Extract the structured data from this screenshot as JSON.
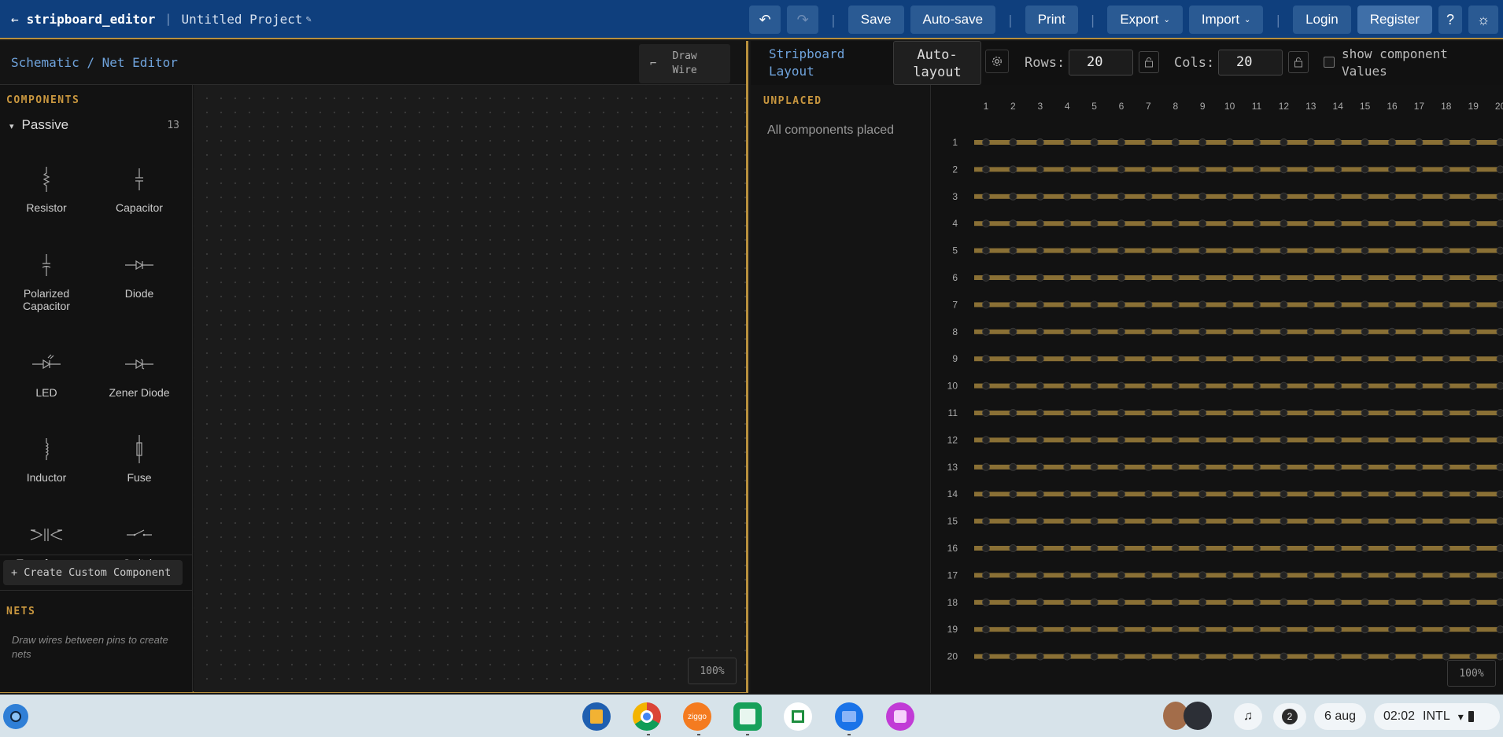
{
  "topbar": {
    "back_label": "←",
    "app_name": "stripboard_editor",
    "separator": "|",
    "project_name": "Untitled Project",
    "pencil_icon": "✎",
    "undo_icon": "↶",
    "redo_icon": "↷",
    "save": "Save",
    "autosave": "Auto-save",
    "print": "Print",
    "export": "Export",
    "import": "Import",
    "login": "Login",
    "register": "Register",
    "help": "?",
    "theme_icon": "☼",
    "caret": "⌄"
  },
  "schematic": {
    "title": "Schematic / Net Editor",
    "draw_wire_line1": "Draw",
    "draw_wire_line2": "Wire",
    "components_title": "COMPONENTS",
    "group_name": "Passive",
    "group_count": "13",
    "group_toggle": "▾",
    "components": [
      {
        "label": "Resistor",
        "icon": "resistor-icon"
      },
      {
        "label": "Capacitor",
        "icon": "capacitor-icon"
      },
      {
        "label": "Polarized Capacitor",
        "icon": "polarized-capacitor-icon"
      },
      {
        "label": "Diode",
        "icon": "diode-icon"
      },
      {
        "label": "LED",
        "icon": "led-icon"
      },
      {
        "label": "Zener Diode",
        "icon": "zener-diode-icon"
      },
      {
        "label": "Inductor",
        "icon": "inductor-icon"
      },
      {
        "label": "Fuse",
        "icon": "fuse-icon"
      },
      {
        "label": "Transformer",
        "icon": "transformer-icon"
      },
      {
        "label": "Switch",
        "icon": "switch-icon"
      }
    ],
    "create_custom": "+ Create Custom Component",
    "nets_title": "NETS",
    "nets_hint": "Draw wires between pins to create nets",
    "zoom": "100%"
  },
  "stripboard": {
    "title_line1": "Stripboard",
    "title_line2": "Layout",
    "autolayout_line1": "Auto-",
    "autolayout_line2": "layout",
    "rows_label": "Rows:",
    "rows_value": "20",
    "cols_label": "Cols:",
    "cols_value": "20",
    "show_values_line1": "show component",
    "show_values_line2": "Values",
    "show_values_checked": false,
    "unplaced_title": "UNPLACED",
    "unplaced_status": "All components placed",
    "rows": 20,
    "cols": 20,
    "zoom": "100%",
    "strip_color": "#8a7035",
    "hole_color": "#222222"
  },
  "taskbar": {
    "date": "6 aug",
    "time": "02:02",
    "locale": "INTL",
    "notification_count": "2",
    "apps": [
      "books-icon",
      "chrome-icon",
      "ziggo-icon",
      "calculator-icon",
      "canvas-icon",
      "files-icon",
      "notes-icon"
    ],
    "ziggo_label": "ziggo"
  },
  "colors": {
    "topbar": "#0f3f7d",
    "accent": "#b8903d",
    "link": "#6fa3dc"
  }
}
